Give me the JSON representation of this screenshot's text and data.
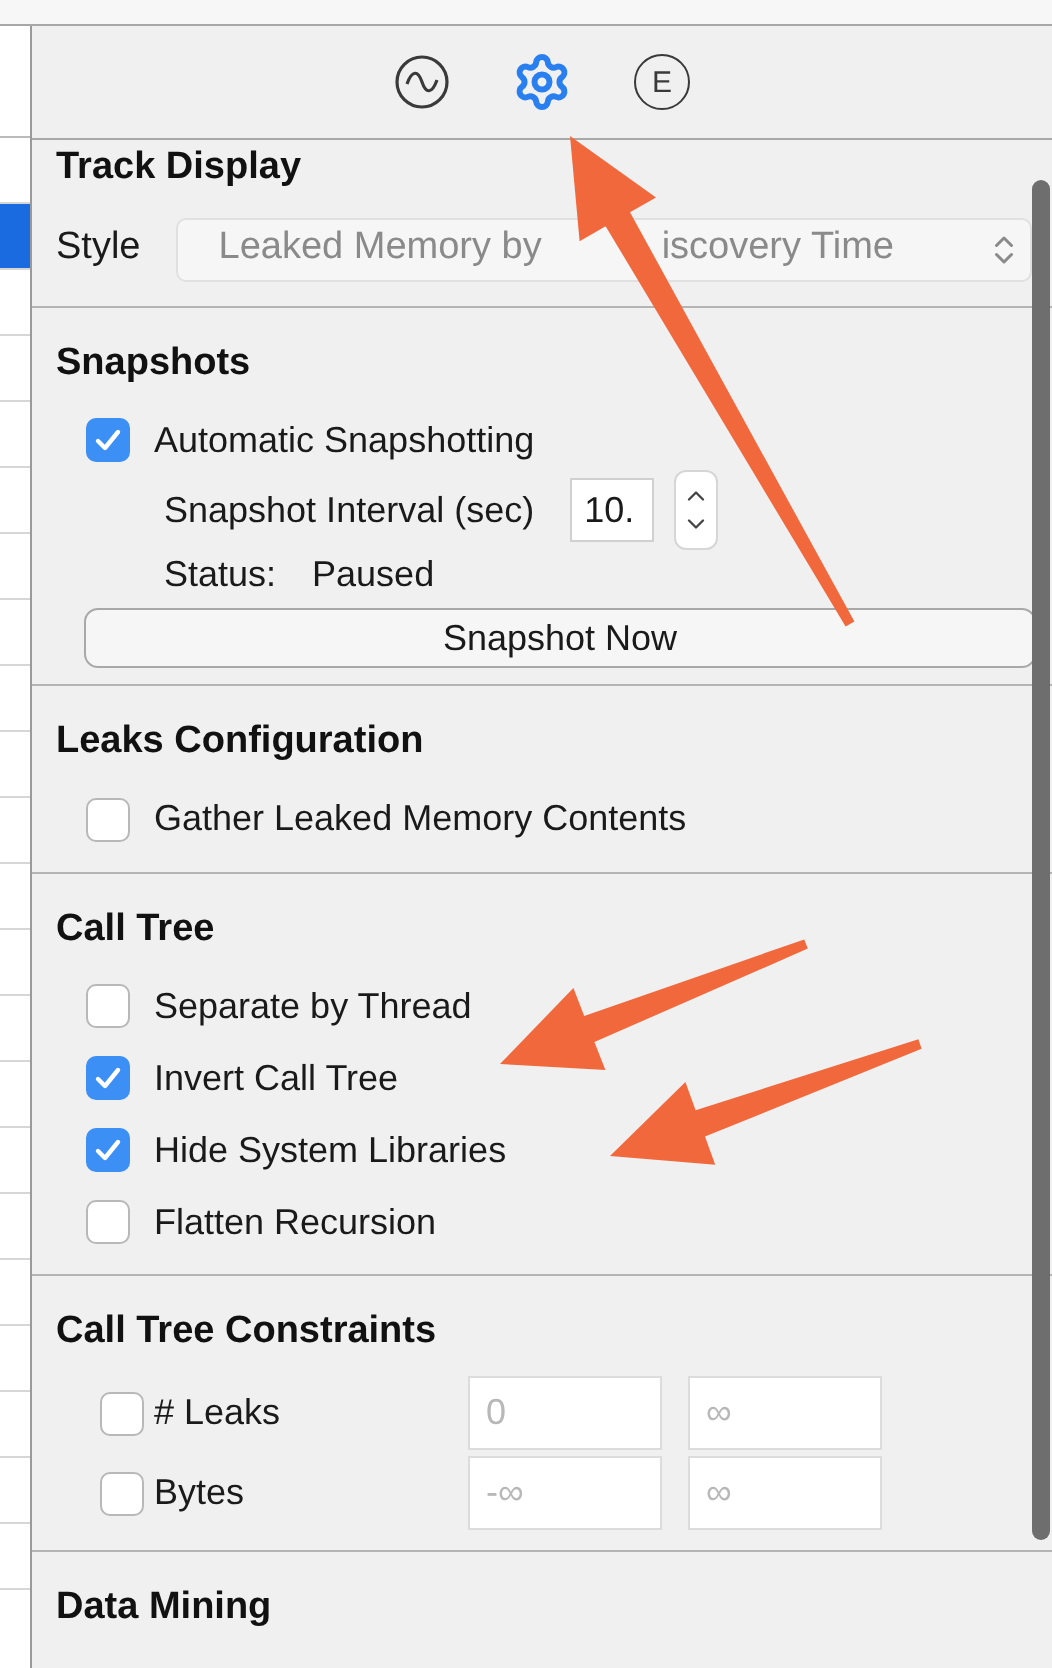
{
  "left_list": {
    "rows": [
      {
        "selected": false
      },
      {
        "selected": true
      },
      {
        "selected": false
      },
      {
        "selected": false
      },
      {
        "selected": false
      },
      {
        "selected": false
      },
      {
        "selected": false
      },
      {
        "selected": false
      },
      {
        "selected": false
      },
      {
        "selected": false
      },
      {
        "selected": false
      },
      {
        "selected": false
      },
      {
        "selected": false
      },
      {
        "selected": false
      },
      {
        "selected": false
      },
      {
        "selected": false
      },
      {
        "selected": false
      },
      {
        "selected": false
      },
      {
        "selected": false
      },
      {
        "selected": false
      },
      {
        "selected": false
      },
      {
        "selected": false
      }
    ]
  },
  "inspector_tabs": [
    {
      "kind": "wave",
      "selected": false
    },
    {
      "kind": "gear",
      "selected": true
    },
    {
      "kind": "letter",
      "label": "E",
      "selected": false
    }
  ],
  "sections": [
    {
      "title": "Track Display",
      "items": [
        {
          "kind": "popup",
          "label": "Style",
          "value_parts": [
            "Leaked Memory by",
            "iscovery Time"
          ]
        }
      ]
    },
    {
      "title": "Snapshots",
      "items": [
        {
          "kind": "checkbox",
          "label": "Automatic Snapshotting",
          "checked": true
        },
        {
          "kind": "stepper",
          "label": "Snapshot Interval (sec)",
          "value": "10."
        },
        {
          "kind": "status",
          "label": "Status:",
          "value": "Paused"
        },
        {
          "kind": "button",
          "label": "Snapshot Now"
        }
      ]
    },
    {
      "title": "Leaks Configuration",
      "items": [
        {
          "kind": "checkbox",
          "label": "Gather Leaked Memory Contents",
          "checked": false
        }
      ]
    },
    {
      "title": "Call Tree",
      "items": [
        {
          "kind": "checkbox",
          "label": "Separate by Thread",
          "checked": false
        },
        {
          "kind": "checkbox",
          "label": "Invert Call Tree",
          "checked": true
        },
        {
          "kind": "checkbox",
          "label": "Hide System Libraries",
          "checked": true
        },
        {
          "kind": "checkbox",
          "label": "Flatten Recursion",
          "checked": false
        }
      ]
    },
    {
      "title": "Call Tree Constraints",
      "items": [
        {
          "kind": "range",
          "label": "# Leaks",
          "checked": false,
          "fields": [
            {
              "placeholder": "0"
            },
            {
              "placeholder": "∞"
            }
          ]
        },
        {
          "kind": "range",
          "label": "Bytes",
          "checked": false,
          "fields": [
            {
              "placeholder": "-∞"
            },
            {
              "placeholder": "∞"
            }
          ]
        }
      ]
    },
    {
      "title": "Data Mining"
    }
  ]
}
